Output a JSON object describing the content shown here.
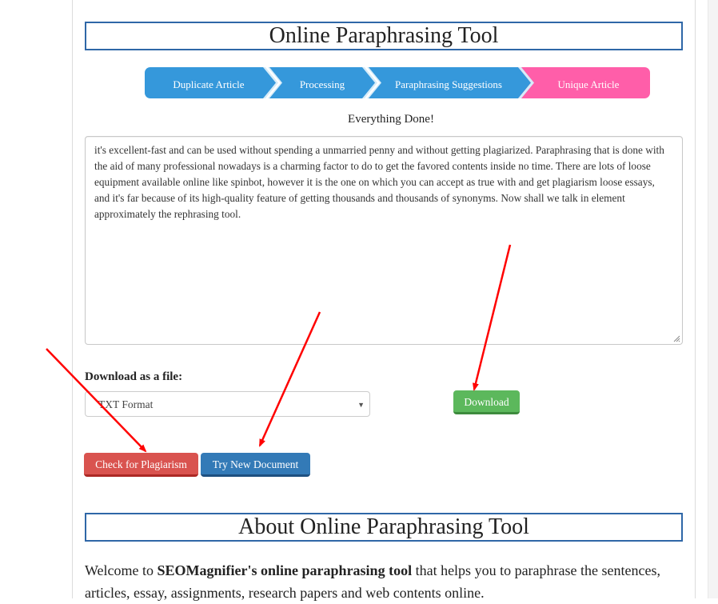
{
  "header": {
    "title": "Online Paraphrasing Tool"
  },
  "steps": [
    {
      "label": "Duplicate Article",
      "state": "done"
    },
    {
      "label": "Processing",
      "state": "done"
    },
    {
      "label": "Paraphrasing Suggestions",
      "state": "done"
    },
    {
      "label": "Unique Article",
      "state": "active"
    }
  ],
  "colors": {
    "step_done": "#3598db",
    "step_active": "#ff5ea9",
    "title_border": "#2f67a7",
    "download": "#5cb85c",
    "plagiarism": "#d9534f",
    "new_document": "#337ab7",
    "annotation_arrow": "#ff0000"
  },
  "status": "Everything Done!",
  "output_text": "it's excellent-fast and can be used without spending a unmarried penny and without getting plagiarized. Paraphrasing that is done with the aid of many professional nowadays is a charming factor to do to get the favored contents inside no time. There are lots of loose equipment available online like spinbot, however it is the one on which you can accept as true with and get plagiarism loose essays, and it's far because of its high-quality feature of getting thousands and thousands of synonyms. Now shall we talk in element approximately the rephrasing tool.",
  "download": {
    "label": "Download as a file:",
    "format_selected": "TXT Format",
    "button": "Download"
  },
  "actions": {
    "check_plagiarism": "Check for Plagiarism",
    "try_new": "Try New Document"
  },
  "about": {
    "title": "About Online Paraphrasing Tool",
    "intro_prefix": "Welcome to ",
    "intro_bold": "SEOMagnifier's online paraphrasing tool",
    "intro_suffix": " that helps you to paraphrase the sentences, articles, essay, assignments, research papers and web contents online."
  }
}
